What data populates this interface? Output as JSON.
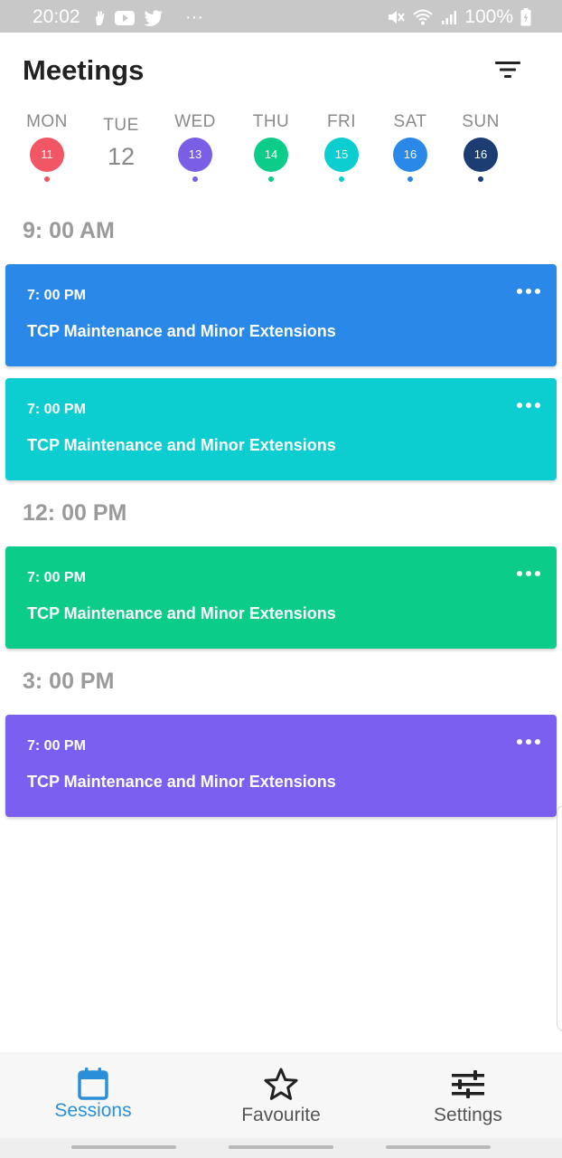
{
  "status_bar": {
    "time": "20:02",
    "overflow": "···",
    "battery": "100%",
    "left_icons": [
      "hand-icon",
      "youtube-icon",
      "twitter-icon"
    ],
    "right_icons": [
      "mute-icon",
      "wifi-icon",
      "signal-icon",
      "battery-icon"
    ]
  },
  "header": {
    "title": "Meetings",
    "filter_icon": "filter-icon"
  },
  "week": {
    "days": [
      {
        "name": "MON",
        "date": "11",
        "color": "#f25563",
        "style": "circle"
      },
      {
        "name": "TUE",
        "date": "12",
        "color": "#888888",
        "style": "plain"
      },
      {
        "name": "WED",
        "date": "13",
        "color": "#7b5ee6",
        "style": "circle"
      },
      {
        "name": "THU",
        "date": "14",
        "color": "#0ccc8a",
        "style": "circle"
      },
      {
        "name": "FRI",
        "date": "15",
        "color": "#0ccdd0",
        "style": "circle"
      },
      {
        "name": "SAT",
        "date": "16",
        "color": "#2a88e8",
        "style": "circle"
      },
      {
        "name": "SUN",
        "date": "16",
        "color": "#1b3d74",
        "style": "circle"
      }
    ]
  },
  "schedule": {
    "headings": [
      "9: 00 AM",
      "12: 00 PM",
      "3: 00 PM"
    ],
    "cards": [
      {
        "time": "7: 00 PM",
        "title": "TCP Maintenance and Minor Extensions",
        "color": "#2a88e8"
      },
      {
        "time": "7: 00 PM",
        "title": "TCP Maintenance and Minor Extensions",
        "color": "#0ccdd0"
      },
      {
        "time": "7: 00 PM",
        "title": "TCP Maintenance and Minor Extensions",
        "color": "#0ccc8a"
      },
      {
        "time": "7: 00 PM",
        "title": "TCP Maintenance and Minor Extensions",
        "color": "#7b5ff0"
      }
    ]
  },
  "bottom_nav": {
    "items": [
      {
        "label": "Sessions",
        "icon": "calendar-icon",
        "active": true,
        "color": "#2a8fd8"
      },
      {
        "label": "Favourite",
        "icon": "star-icon",
        "active": false,
        "color": "#555555"
      },
      {
        "label": "Settings",
        "icon": "sliders-icon",
        "active": false,
        "color": "#555555"
      }
    ]
  }
}
